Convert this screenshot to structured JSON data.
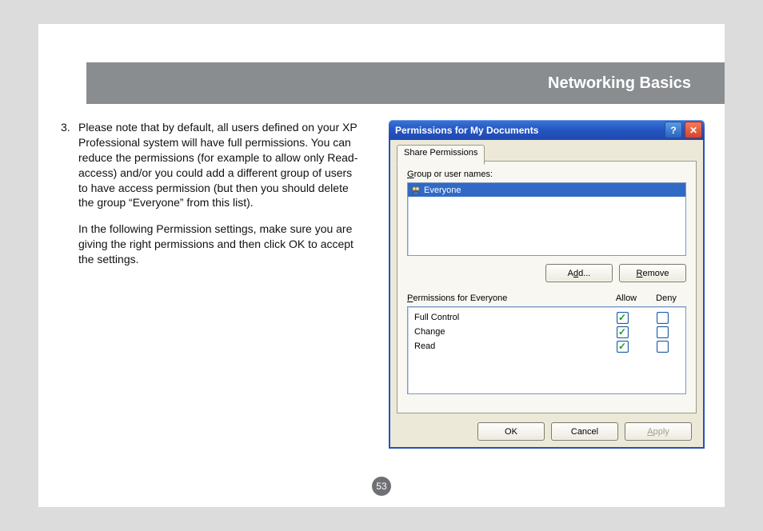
{
  "header": {
    "title": "Networking Basics"
  },
  "text": {
    "item_number": "3.",
    "paragraph1": "Please note that by default, all users defined on your XP Professional system will have full permissions.  You can reduce the permissions (for example to allow only Read-access) and/or you could add a different group of users to have access permission (but then you should delete the group “Everyone” from this list).",
    "paragraph2": "In the following Permission settings, make sure you are giving the right permissions and then click OK to accept the settings."
  },
  "dialog": {
    "title": "Permissions for My Documents",
    "tab_label": "Share Permissions",
    "group_label_pre": "G",
    "group_label_post": "roup or user names:",
    "list_item": "Everyone",
    "add_label_pre": "A",
    "add_label_u": "d",
    "add_label_post": "d...",
    "remove_label_u": "R",
    "remove_label_post": "emove",
    "perm_header_pre": "P",
    "perm_header_post": "ermissions for Everyone",
    "col_allow": "Allow",
    "col_deny": "Deny",
    "perms": [
      {
        "name": "Full Control",
        "allow": true,
        "deny": false
      },
      {
        "name": "Change",
        "allow": true,
        "deny": false
      },
      {
        "name": "Read",
        "allow": true,
        "deny": false
      }
    ],
    "ok_label": "OK",
    "cancel_label": "Cancel",
    "apply_label_u": "A",
    "apply_label_post": "pply"
  },
  "page_number": "53"
}
